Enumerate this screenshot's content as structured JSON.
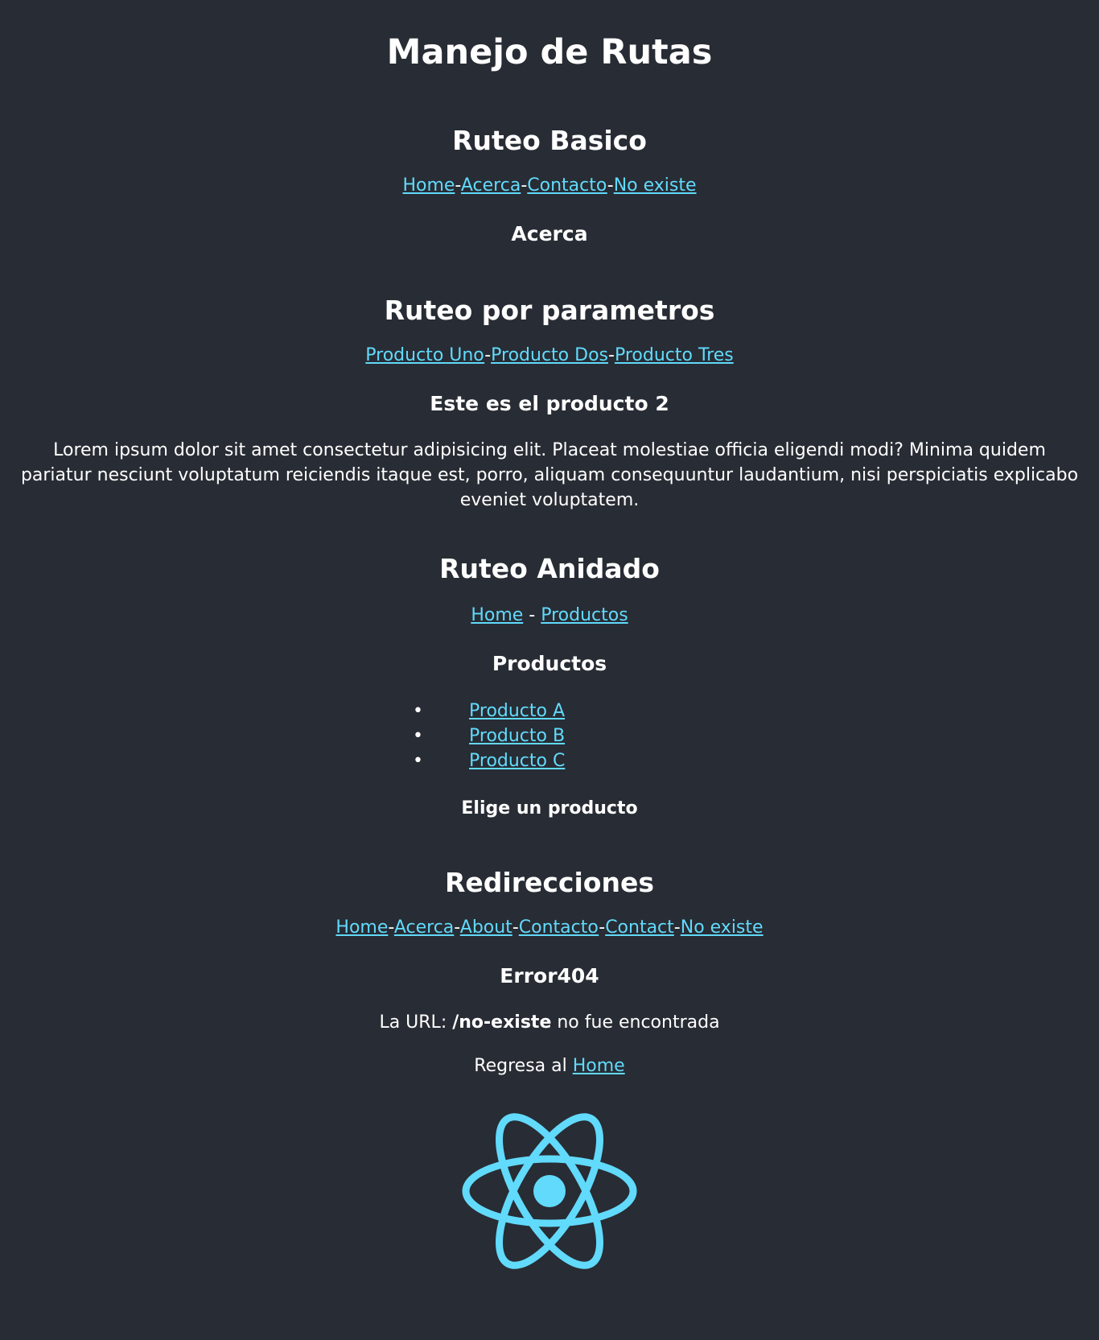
{
  "app": {
    "title": "Manejo de Rutas"
  },
  "basic": {
    "heading": "Ruteo Basico",
    "links": [
      "Home",
      "Acerca",
      "Contacto",
      "No existe"
    ],
    "separator": "-",
    "current": "Acerca"
  },
  "params": {
    "heading": "Ruteo por parametros",
    "links": [
      "Producto Uno",
      "Producto Dos",
      "Producto Tres"
    ],
    "separator": "-",
    "current": "Este es el producto 2",
    "description": "Lorem ipsum dolor sit amet consectetur adipisicing elit. Placeat molestiae officia eligendi modi? Minima quidem pariatur nesciunt voluptatum reiciendis itaque est, porro, aliquam consequuntur laudantium, nisi perspiciatis explicabo eveniet voluptatem."
  },
  "nested": {
    "heading": "Ruteo Anidado",
    "links": [
      "Home",
      "Productos"
    ],
    "separator": " - ",
    "subheading": "Productos",
    "products": [
      "Producto A",
      "Producto B",
      "Producto C"
    ],
    "bullet": "•",
    "prompt": "Elige un producto"
  },
  "redirects": {
    "heading": "Redirecciones",
    "links": [
      "Home",
      "Acerca",
      "About",
      "Contacto",
      "Contact",
      "No existe"
    ],
    "separator": "-",
    "error_title": "Error404",
    "url_prefix": "La URL: ",
    "url_path": "/no-existe",
    "url_suffix": " no fue encontrada",
    "back_prefix": "Regresa al ",
    "back_link": "Home"
  },
  "logo": {
    "icon": "react-logo-icon",
    "color": "#61dafb"
  },
  "colors": {
    "background": "#282c34",
    "link": "#61dafb",
    "text": "#ffffff"
  }
}
